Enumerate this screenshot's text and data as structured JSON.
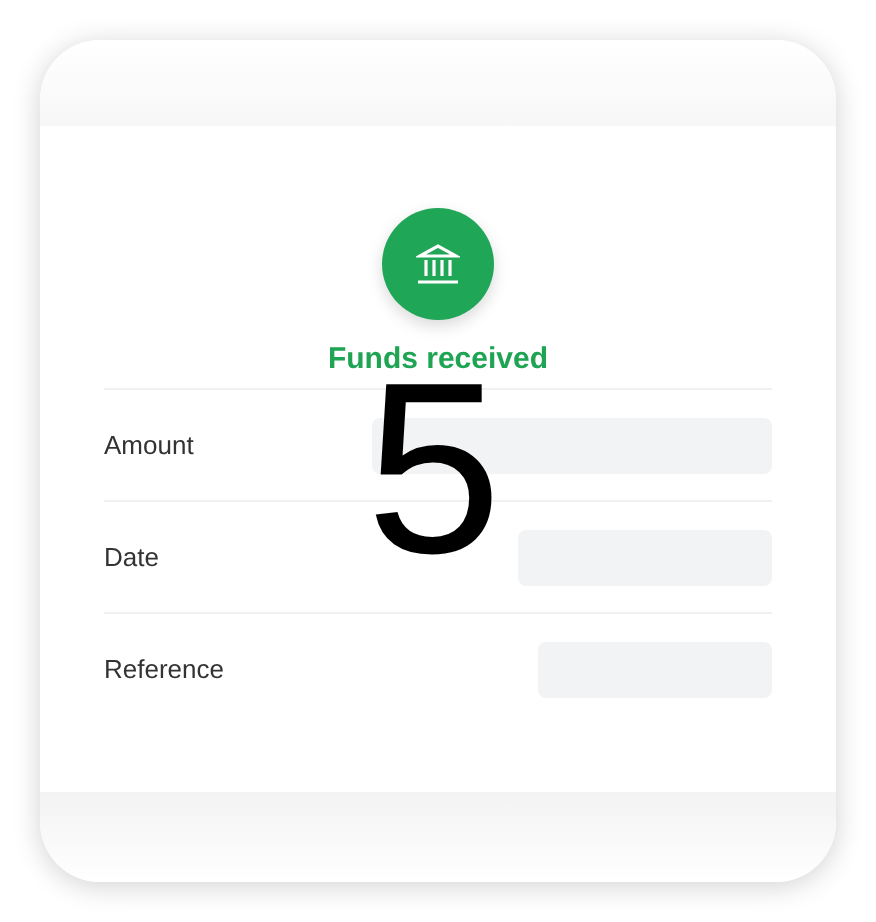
{
  "status": {
    "title": "Funds received"
  },
  "details": [
    {
      "label": "Amount"
    },
    {
      "label": "Date"
    },
    {
      "label": "Reference"
    }
  ],
  "step_number": "5"
}
